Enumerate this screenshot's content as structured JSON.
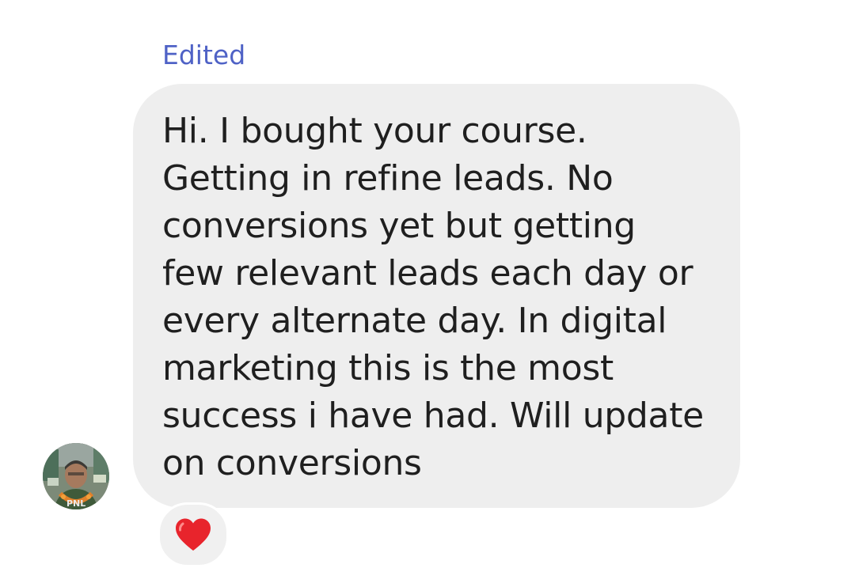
{
  "message": {
    "edited_label": "Edited",
    "lines": [
      "Hi. I bought your course.",
      "Getting in refine leads. No",
      "conversions yet but getting",
      "few relevant leads each day or",
      "every alternate day. In digital",
      "marketing this is the most",
      "success i have had. Will update",
      "on conversions"
    ],
    "bubble_color": "#eeeeee",
    "text_color": "#1f1f1f",
    "edited_color": "#4f62c6"
  },
  "sender": {
    "avatar_icon": "sender-avatar"
  },
  "reaction": {
    "icon": "red-heart-icon",
    "color": "#e8242c"
  }
}
